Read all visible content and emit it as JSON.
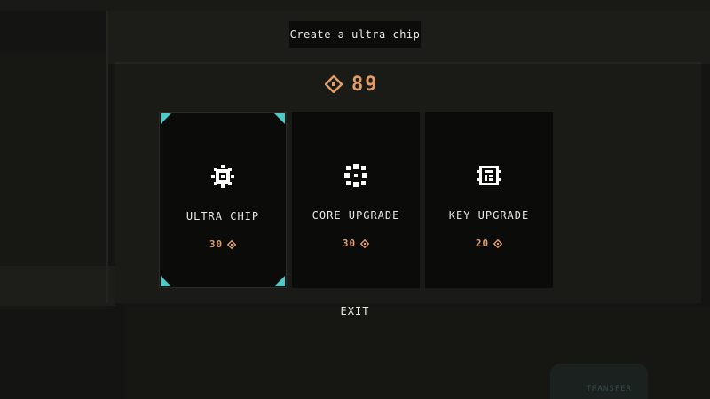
{
  "title": "Create a ultra chip",
  "currency": {
    "icon": "diamond-coin-icon",
    "amount": "89",
    "color": "#e29c6a"
  },
  "cards": [
    {
      "label": "ULTRA CHIP",
      "cost": "30",
      "icon": "gear-chip-icon",
      "selected": true
    },
    {
      "label": "CORE UPGRADE",
      "cost": "30",
      "icon": "core-burst-icon",
      "selected": false
    },
    {
      "label": "KEY UPGRADE",
      "cost": "20",
      "icon": "key-chip-icon",
      "selected": false
    }
  ],
  "exit_label": "EXIT",
  "colors": {
    "accent": "#4fc8c8",
    "price": "#e29c6a",
    "text": "#e9e9e4",
    "card_bg": "#0b0b0a"
  },
  "background_sign": "TRANSFER"
}
